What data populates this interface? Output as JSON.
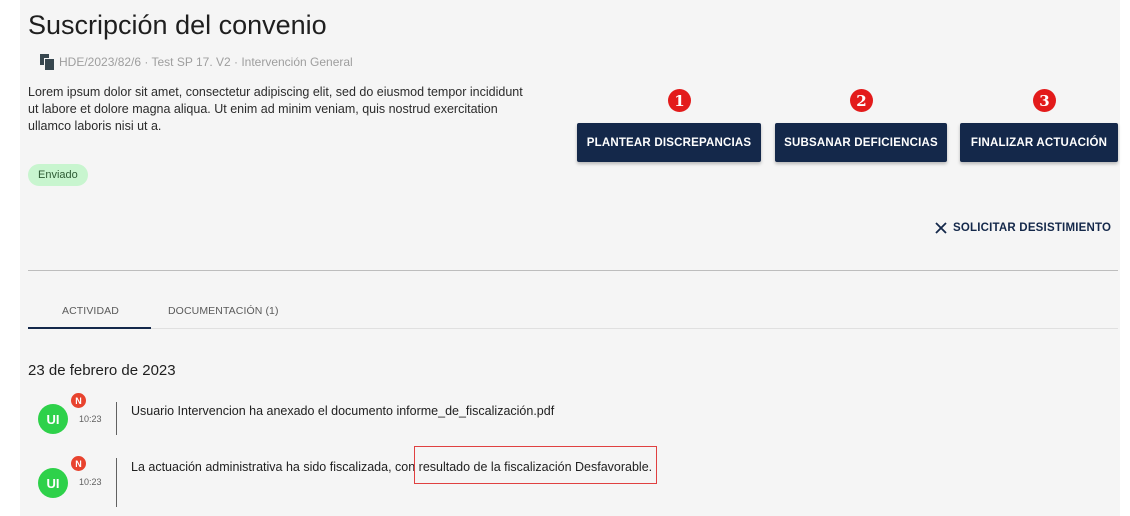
{
  "header": {
    "title": "Suscripción del convenio",
    "meta": "HDE/2023/82/6 · Test SP 17. V2 · Intervención General",
    "description": "Lorem ipsum dolor sit amet, consectetur adipiscing elit, sed do eiusmod tempor incididunt ut labore et dolore magna aliqua. Ut enim ad minim veniam, quis nostrud exercitation ullamco laboris nisi ut a.",
    "status": "Enviado"
  },
  "actions": {
    "discrepancias": "PLANTEAR DISCREPANCIAS",
    "deficiencias": "SUBSANAR DEFICIENCIAS",
    "finalizar": "FINALIZAR ACTUACIÓN",
    "desistimiento": "SOLICITAR DESISTIMIENTO"
  },
  "markers": [
    "1",
    "2",
    "3"
  ],
  "tabs": {
    "actividad": "ACTIVIDAD",
    "documentacion": "DOCUMENTACIÓN (1)"
  },
  "activity": {
    "date": "23 de febrero de 2023",
    "items": [
      {
        "initials": "UI",
        "badge": "N",
        "time": "10:23",
        "text": "Usuario Intervencion ha anexado el documento informe_de_fiscalización.pdf"
      },
      {
        "initials": "UI",
        "badge": "N",
        "time": "10:23",
        "text": "La actuación administrativa ha sido fiscalizada, con resultado de la fiscalización Desfavorable."
      }
    ]
  },
  "colors": {
    "primary": "#14284a",
    "marker": "#e31b1b",
    "avatar": "#2ed14a",
    "badge_bg": "#c8f5cf"
  }
}
